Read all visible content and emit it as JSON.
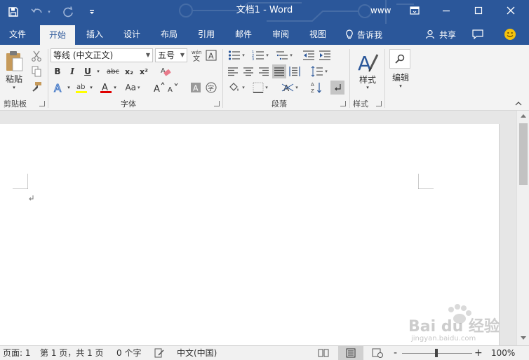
{
  "titlebar": {
    "doc_title": "文档1  -  Word",
    "user": "www",
    "qat": {
      "save_icon": "save-icon",
      "undo_icon": "undo-icon",
      "redo_icon": "redo-icon",
      "customize_icon": "customize-qat-icon"
    }
  },
  "tabs": [
    {
      "label": "文件"
    },
    {
      "label": "开始"
    },
    {
      "label": "插入"
    },
    {
      "label": "设计"
    },
    {
      "label": "布局"
    },
    {
      "label": "引用"
    },
    {
      "label": "邮件"
    },
    {
      "label": "审阅"
    },
    {
      "label": "视图"
    }
  ],
  "tell_me": "告诉我",
  "share": "共享",
  "ribbon": {
    "clipboard": {
      "paste_label": "粘贴",
      "group_label": "剪贴板"
    },
    "font": {
      "font_name": "等线 (中文正文)",
      "font_size": "五号",
      "group_label": "字体",
      "bold": "B",
      "italic": "I",
      "underline": "U",
      "strike": "abc",
      "subscript": "x₂",
      "superscript": "x²",
      "case": "Aa"
    },
    "paragraph": {
      "group_label": "段落"
    },
    "styles": {
      "label": "样式",
      "group_label": "样式"
    },
    "editing": {
      "label": "编辑"
    }
  },
  "status": {
    "page": "页面: 1",
    "page_of": "第 1 页，共 1 页",
    "words": "0 个字",
    "language": "中文(中国)",
    "zoom": "100%",
    "zoom_minus": "-",
    "zoom_plus": "+"
  },
  "watermark": {
    "brand": "Bai du 经验",
    "url": "jingyan.baidu.com"
  },
  "colors": {
    "brand": "#2b579a",
    "ribbon_bg": "#f3f3f3",
    "doc_bg": "#e6e6e6"
  }
}
